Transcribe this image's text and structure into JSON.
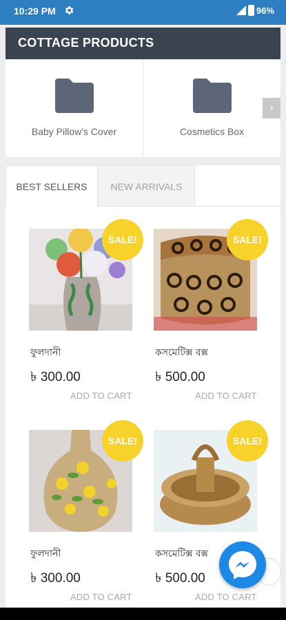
{
  "status_bar": {
    "time": "10:29 PM",
    "battery": "96%",
    "icons": [
      "gear-icon",
      "signal-icon",
      "battery-icon"
    ]
  },
  "categories": {
    "title": "COTTAGE PRODUCTS",
    "items": [
      {
        "label": "Baby Pillow's Cover",
        "icon": "folder-icon"
      },
      {
        "label": "Cosmetics Box",
        "icon": "folder-icon"
      }
    ],
    "next_icon": "chevron-right-icon"
  },
  "tabs": [
    {
      "label": "BEST SELLERS",
      "active": true
    },
    {
      "label": "NEW ARRIVALS",
      "active": false
    }
  ],
  "products": [
    {
      "name": "ফুলদানী",
      "price": "৳ 300.00",
      "badge": "SALE!",
      "action": "ADD TO CART"
    },
    {
      "name": "কসমেটিক্স বক্স",
      "price": "৳ 500.00",
      "badge": "SALE!",
      "action": "ADD TO CART"
    },
    {
      "name": "ফুলদানী",
      "price": "৳ 300.00",
      "badge": "SALE!",
      "action": "ADD TO CART"
    },
    {
      "name": "কসমেটিক্স বক্স",
      "price": "৳ 500.00",
      "badge": "SALE!",
      "action": "ADD TO CART"
    }
  ],
  "colors": {
    "status_bar": "#2e7ec2",
    "header": "#3a4450",
    "sale_badge": "#f6d22a",
    "messenger": "#1e88e5"
  },
  "fab": {
    "icon": "messenger-icon"
  }
}
